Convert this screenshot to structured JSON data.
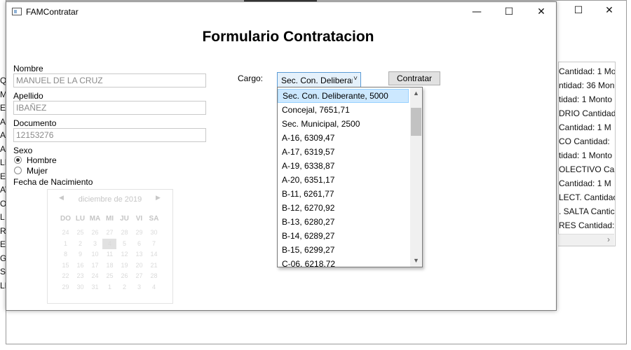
{
  "background_window": {
    "controls": {
      "minimize": "—",
      "maximize": "☐",
      "close": "✕"
    },
    "right_list": [
      " Cantidad: 1 Mo",
      "ntidad: 36 Mon",
      "tidad: 1 Monto",
      "DRIO Cantidad",
      " Cantidad: 1 M",
      "CO Cantidad:",
      "tidad: 1 Monto",
      "OLECTIVO Cant",
      " Cantidad: 1 M",
      "LECT. Cantidac",
      ". SALTA Cantic",
      "RES Cantidad:"
    ],
    "right_list_scroll_arrow": "›",
    "left_strip": [
      "Q",
      "ME",
      "ER",
      "A",
      "AI",
      "A",
      "LI",
      "E",
      "AV",
      "OO",
      "L",
      "RO",
      "ER",
      "G",
      "SE",
      "LE"
    ]
  },
  "window": {
    "title": "FAMContratar",
    "controls": {
      "minimize": "—",
      "maximize": "☐",
      "close": "✕"
    }
  },
  "form": {
    "title": "Formulario Contratacion",
    "nombre_label": "Nombre",
    "nombre_value": "MANUEL DE LA CRUZ",
    "apellido_label": "Apellido",
    "apellido_value": "IBAÑEZ",
    "documento_label": "Documento",
    "documento_value": "12153276",
    "sexo_label": "Sexo",
    "sexo_options": [
      "Hombre",
      "Mujer"
    ],
    "sexo_selected": "Hombre",
    "fecha_label": "Fecha de Nacimiento",
    "cargo_label": "Cargo:",
    "cargo_selected": "Sec. Con. Deliberante, 5000",
    "contratar_button": "Contratar"
  },
  "calendar": {
    "month": "diciembre de 2019",
    "prev": "◀",
    "next": "▶",
    "weekdays": [
      "DO",
      "LU",
      "MA",
      "MI",
      "JU",
      "VI",
      "SA"
    ],
    "weeks": [
      [
        "24",
        "25",
        "26",
        "27",
        "28",
        "29",
        "30"
      ],
      [
        "1",
        "2",
        "3",
        "4",
        "5",
        "6",
        "7"
      ],
      [
        "8",
        "9",
        "10",
        "11",
        "12",
        "13",
        "14"
      ],
      [
        "15",
        "16",
        "17",
        "18",
        "19",
        "20",
        "21"
      ],
      [
        "22",
        "23",
        "24",
        "25",
        "26",
        "27",
        "28"
      ],
      [
        "29",
        "30",
        "31",
        "1",
        "2",
        "3",
        "4"
      ]
    ],
    "today": "4"
  },
  "cargo_options": [
    "Sec. Con. Deliberante, 5000",
    "Concejal, 7651,71",
    "Sec. Municipal, 2500",
    "A-16, 6309,47",
    "A-17, 6319,57",
    "A-19, 6338,87",
    "A-20, 6351,17",
    "B-11, 6261,77",
    "B-12, 6270,92",
    "B-13, 6280,27",
    "B-14, 6289,27",
    "B-15, 6299,27",
    "C-06, 6218,72"
  ],
  "dropdown_scroll": {
    "up": "▲",
    "down": "▼"
  }
}
